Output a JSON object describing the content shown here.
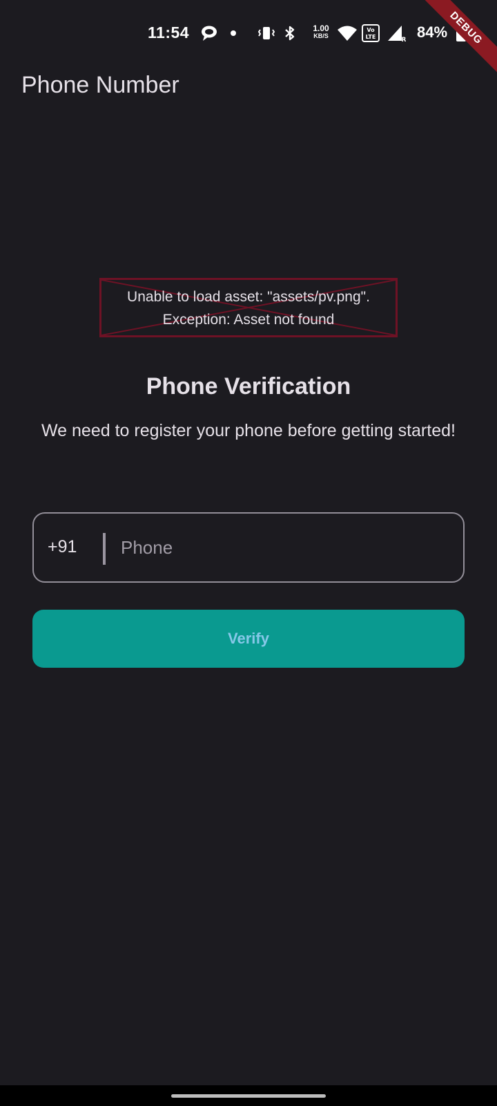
{
  "status_bar": {
    "time": "11:54",
    "net_speed_value": "1.00",
    "net_speed_unit": "KB/S",
    "battery_percent": "84%",
    "icons": [
      "chat-bubble-icon",
      "dot-icon",
      "vibrate-icon",
      "bluetooth-icon",
      "wifi-icon",
      "volte-icon",
      "signal-icon",
      "battery-icon"
    ]
  },
  "debug_banner": {
    "label": "DEBUG",
    "color": "#8b1a22"
  },
  "app_bar": {
    "title": "Phone Number"
  },
  "asset_error": {
    "line1": "Unable to load asset: \"assets/pv.png\".",
    "line2": "Exception: Asset not found",
    "border_color": "#6e1225"
  },
  "main": {
    "heading": "Phone Verification",
    "subtext": "We need to register your phone before getting started!"
  },
  "phone_field": {
    "country_code": "+91",
    "placeholder": "Phone",
    "value": ""
  },
  "verify_button": {
    "label": "Verify",
    "color": "#0a9a90"
  },
  "colors": {
    "background": "#1c1b20",
    "text": "#e6e1e8",
    "outline": "#938f99"
  }
}
